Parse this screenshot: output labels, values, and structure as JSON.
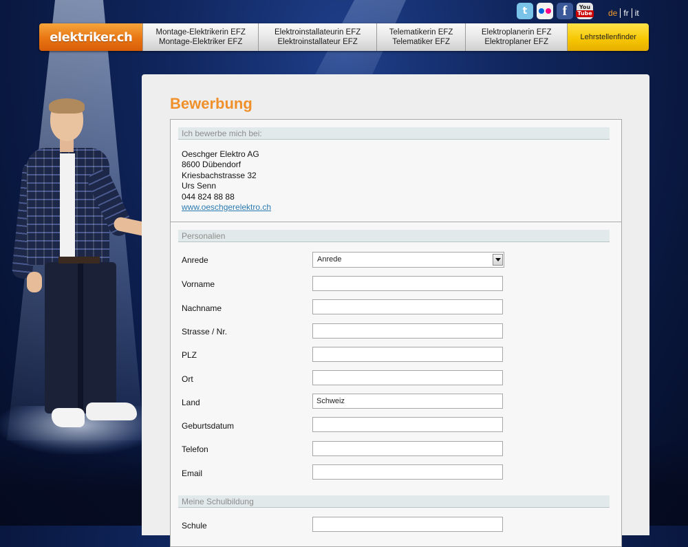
{
  "social": {
    "twitter_icon": "twitter-icon",
    "flickr_icon": "flickr-icon",
    "facebook_icon": "facebook-icon",
    "youtube_icon": "youtube-icon",
    "twitter_glyph": "t",
    "facebook_glyph": "f",
    "youtube_top": "You",
    "youtube_bottom": "Tube"
  },
  "languages": [
    {
      "code": "de",
      "active": true
    },
    {
      "code": "fr",
      "active": false
    },
    {
      "code": "it",
      "active": false
    }
  ],
  "nav": {
    "logo": "elektriker.ch",
    "items": [
      {
        "line1": "Montage-Elektrikerin EFZ",
        "line2": "Montage-Elektriker EFZ"
      },
      {
        "line1": "Elektroinstallateurin EFZ",
        "line2": "Elektroinstallateur EFZ"
      },
      {
        "line1": "Telematikerin EFZ",
        "line2": "Telematiker EFZ"
      },
      {
        "line1": "Elektroplanerin EFZ",
        "line2": "Elektroplaner EFZ"
      }
    ],
    "finder": "Lehrstellenfinder",
    "accent": "#e87512",
    "finder_color": "#f6c500"
  },
  "page": {
    "title": "Bewerbung",
    "title_color": "#f0902a"
  },
  "apply_section": {
    "heading": "Ich bewerbe mich bei:",
    "company": "Oeschger Elektro AG",
    "zip_city": "8600 Dübendorf",
    "street": "Kriesbachstrasse 32",
    "contact": "Urs Senn",
    "phone": "044 824 88 88",
    "website": "www.oeschgerelektro.ch"
  },
  "personalien": {
    "heading": "Personalien",
    "anrede_label": "Anrede",
    "anrede_value": "Anrede",
    "vorname_label": "Vorname",
    "vorname_value": "",
    "nachname_label": "Nachname",
    "nachname_value": "",
    "strasse_label": "Strasse / Nr.",
    "strasse_value": "",
    "plz_label": "PLZ",
    "plz_value": "",
    "ort_label": "Ort",
    "ort_value": "",
    "land_label": "Land",
    "land_value": "Schweiz",
    "geburtsdatum_label": "Geburtsdatum",
    "geburtsdatum_value": "",
    "telefon_label": "Telefon",
    "telefon_value": "",
    "email_label": "Email",
    "email_value": ""
  },
  "schulbildung": {
    "heading": "Meine Schulbildung",
    "schule_label": "Schule",
    "schule_value": ""
  }
}
